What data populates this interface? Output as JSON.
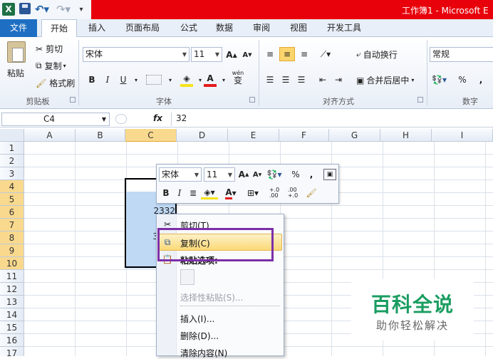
{
  "window": {
    "title": "工作簿1 - Microsoft E",
    "app_icon": "X",
    "brand_color": "#e8000b"
  },
  "tabs": [
    {
      "label": "文件"
    },
    {
      "label": "开始"
    },
    {
      "label": "插入"
    },
    {
      "label": "页面布局"
    },
    {
      "label": "公式"
    },
    {
      "label": "数据"
    },
    {
      "label": "审阅"
    },
    {
      "label": "视图"
    },
    {
      "label": "开发工具"
    }
  ],
  "ribbon": {
    "clipboard": {
      "group_label": "剪贴板",
      "paste": "粘贴",
      "cut": "剪切",
      "copy": "复制",
      "format_painter": "格式刷"
    },
    "font": {
      "group_label": "字体",
      "font_name": "宋体",
      "font_size": "11",
      "bold": "B",
      "italic": "I",
      "underline": "U",
      "wen": "wén",
      "phonetic": "变"
    },
    "alignment": {
      "group_label": "对齐方式",
      "wrap_text": "自动换行",
      "merge_center": "合并后居中"
    },
    "number": {
      "group_label": "数字",
      "format": "常规",
      "percent": "%",
      "comma": ","
    }
  },
  "formula_bar": {
    "name_box": "C4",
    "fx": "fx",
    "value": "32"
  },
  "grid": {
    "columns": [
      "A",
      "B",
      "C",
      "D",
      "E",
      "F",
      "G",
      "H",
      "I"
    ],
    "rows": [
      "1",
      "2",
      "3",
      "4",
      "5",
      "6",
      "7",
      "8",
      "9",
      "10",
      "11",
      "12",
      "13",
      "14",
      "15",
      "16",
      "17"
    ],
    "cells": {
      "C6": "2332",
      "C8": "3"
    }
  },
  "mini_toolbar": {
    "font_name": "宋体",
    "font_size": "11",
    "percent": "%",
    "comma": ",",
    "bold": "B",
    "italic": "I",
    "inc_decimal": "+.0\n.00",
    "dec_decimal": ".00\n+.0"
  },
  "context_menu": {
    "items": [
      {
        "label": "剪切(T)",
        "icon": "scissors-icon",
        "enabled": true
      },
      {
        "label": "复制(C)",
        "icon": "copy-icon",
        "enabled": true
      },
      {
        "label": "粘贴选项:",
        "icon": "paste-icon",
        "enabled": true
      },
      {
        "label": "选择性粘贴(S)...",
        "enabled": false
      },
      {
        "label": "插入(I)...",
        "enabled": true
      },
      {
        "label": "删除(D)...",
        "enabled": true
      },
      {
        "label": "清除内容(N)",
        "enabled": true
      }
    ],
    "highlight_color": "#7d2fa8"
  },
  "watermark": {
    "title": "百科全说",
    "subtitle": "助你轻松解决",
    "color": "#1a9d61"
  }
}
